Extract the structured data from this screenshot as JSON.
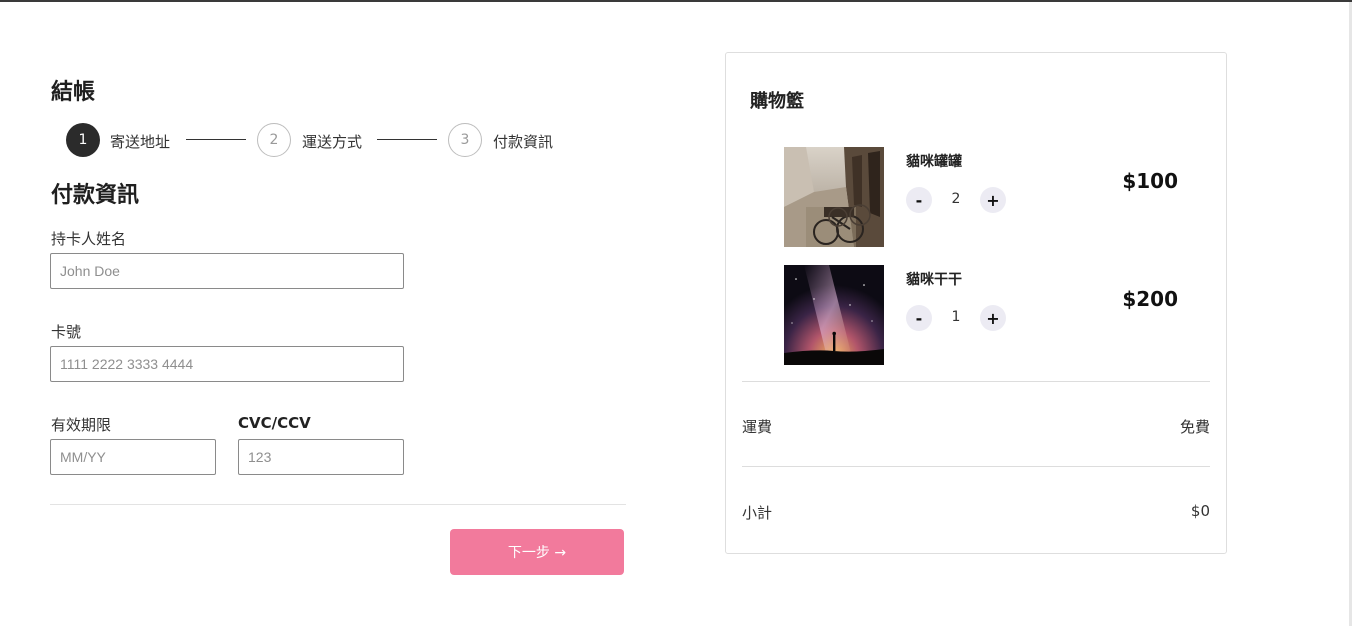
{
  "checkout": {
    "title": "結帳",
    "steps": [
      {
        "number": "1",
        "label": "寄送地址",
        "active": true
      },
      {
        "number": "2",
        "label": "運送方式",
        "active": false
      },
      {
        "number": "3",
        "label": "付款資訊",
        "active": false
      }
    ],
    "section_title": "付款資訊",
    "fields": {
      "cardholder": {
        "label": "持卡人姓名",
        "placeholder": "John Doe",
        "value": ""
      },
      "card_number": {
        "label": "卡號",
        "placeholder": "1111 2222 3333 4444",
        "value": ""
      },
      "expiry": {
        "label": "有效期限",
        "placeholder": "MM/YY",
        "value": ""
      },
      "cvc": {
        "label": "CVC/CCV",
        "placeholder": "123",
        "value": ""
      }
    },
    "next_button": "下一步 →"
  },
  "cart": {
    "title": "購物籃",
    "items": [
      {
        "name": "貓咪罐罐",
        "quantity": "2",
        "price": "$100",
        "decrement": "-",
        "increment": "+"
      },
      {
        "name": "貓咪干干",
        "quantity": "1",
        "price": "$200",
        "decrement": "-",
        "increment": "+"
      }
    ],
    "shipping": {
      "label": "運費",
      "value": "免費"
    },
    "subtotal": {
      "label": "小計",
      "value": "$0"
    }
  },
  "colors": {
    "accent": "#f27a9c",
    "active_step": "#2b2b2b",
    "qty_button_bg": "#ecebf3"
  }
}
